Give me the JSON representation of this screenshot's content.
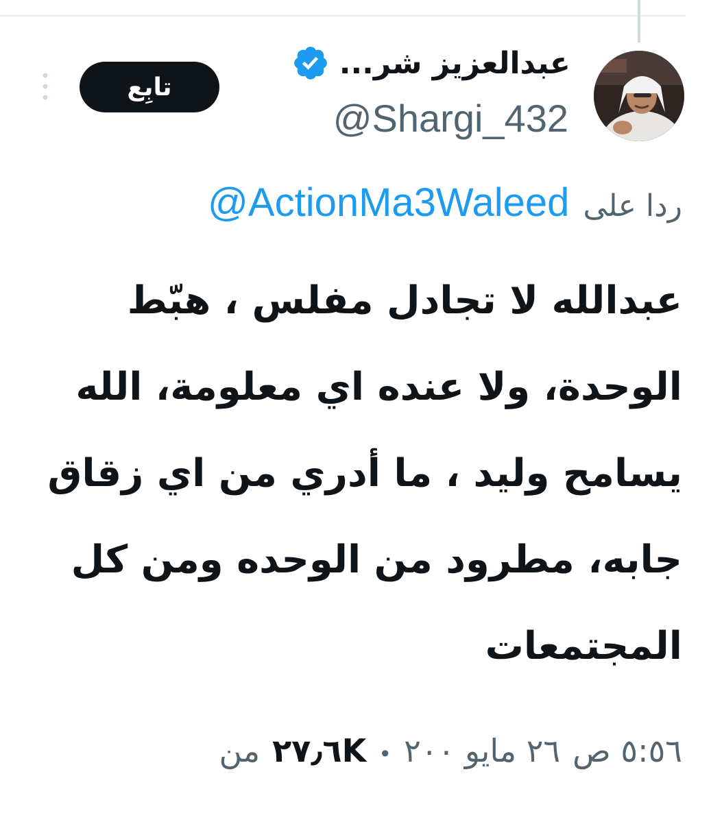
{
  "tweet": {
    "author": {
      "display_name": "عبدالعزيز شر...",
      "handle": "@Shargi_432",
      "verified": true,
      "avatar_icon": "user-photo"
    },
    "follow_label": "تابِع",
    "more_icon": "more-vertical-icon",
    "reply_to": {
      "prefix": "ردا على",
      "mention": "@ActionMa3Waleed"
    },
    "text_lines": [
      "عبدالله لا تجادل مفلس ، هبّط",
      "الوحدة، ولا عنده اي معلومة، الله",
      "يسامح  وليد ، ما أدري من اي زقاق",
      "جابه، مطرود من الوحده ومن كل",
      "المجتمعات"
    ],
    "meta": {
      "time": "٥:٥٦ ص",
      "date": "٢٦ مايو ٢٠٠",
      "views": "٢٧٫٦K",
      "views_suffix": "من"
    }
  },
  "colors": {
    "accent": "#1d9bf0",
    "text_primary": "#0f1419",
    "text_secondary": "#536471",
    "button_bg": "#0f1419",
    "divider": "#e6e9ec"
  }
}
